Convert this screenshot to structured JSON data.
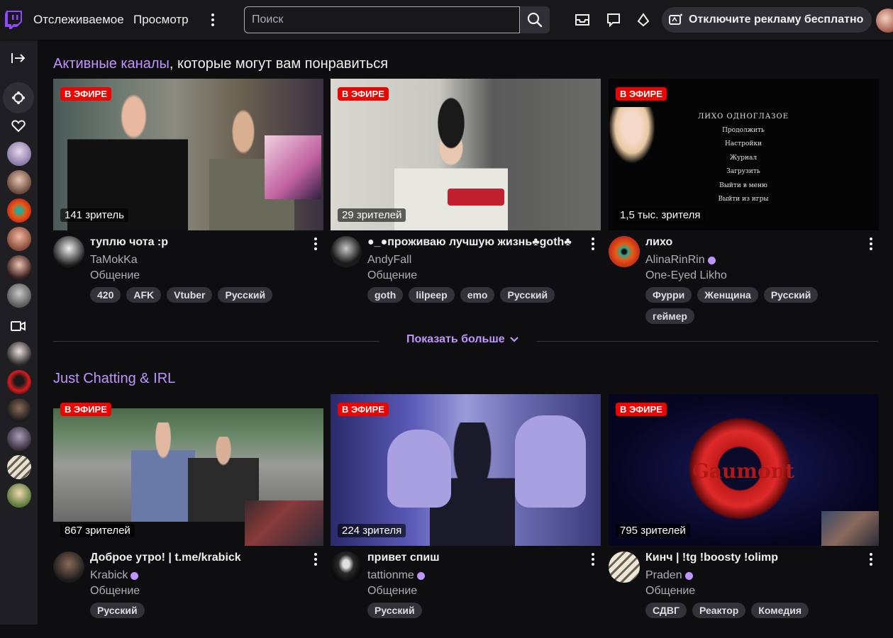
{
  "topnav": {
    "following": "Отслеживаемое",
    "browse": "Просмотр",
    "search_placeholder": "Поиск",
    "promo": "Отключите рекламу бесплатно"
  },
  "sections": [
    {
      "title_accent": "Активные каналы",
      "title_rest": ", которые могут вам понравиться",
      "cards": [
        {
          "live": "В ЭФИРЕ",
          "viewers": "141 зритель",
          "title": "туплю чота :p",
          "channel": "TaMokKa",
          "verified": false,
          "category": "Общение",
          "tags": [
            "420",
            "AFK",
            "Vtuber",
            "Русский"
          ]
        },
        {
          "live": "В ЭФИРЕ",
          "viewers": "29 зрителей",
          "title": "●_●проживаю лучшую жизнь♣goth♣",
          "channel": "AndyFall",
          "verified": false,
          "category": "Общение",
          "tags": [
            "goth",
            "lilpeep",
            "emo",
            "Русский"
          ]
        },
        {
          "live": "В ЭФИРЕ",
          "viewers": "1,5 тыс. зрителя",
          "title": "лихо",
          "channel": "AlinaRinRin",
          "verified": true,
          "category": "One-Eyed Likho",
          "tags": [
            "Фурри",
            "Женщина",
            "Русский",
            "геймер"
          ]
        }
      ]
    },
    {
      "title_accent": "Just Chatting & IRL",
      "title_rest": "",
      "cards": [
        {
          "live": "В ЭФИРЕ",
          "viewers": "867 зрителей",
          "title": "Доброе утро! | t.me/krabick",
          "channel": "Krabick",
          "verified": true,
          "category": "Общение",
          "tags": [
            "Русский"
          ]
        },
        {
          "live": "В ЭФИРЕ",
          "viewers": "224 зрителя",
          "title": "привет спиш",
          "channel": "tattionme",
          "verified": true,
          "category": "Общение",
          "tags": [
            "Русский"
          ]
        },
        {
          "live": "В ЭФИРЕ",
          "viewers": "795 зрителей",
          "title": "Кинч | !tg !boosty !olimp",
          "channel": "Praden",
          "verified": true,
          "category": "Общение",
          "tags": [
            "СДВГ",
            "Реактор",
            "Комедия"
          ]
        }
      ]
    }
  ],
  "show_more": "Показать больше",
  "thumb_texts": {
    "game_menu_title": "ЛИХО ОДНОГЛАЗОЕ",
    "game_menu_items": [
      "Продолжить",
      "Настройки",
      "Журнал",
      "Загрузить",
      "Выйти в меню",
      "Выйти из игры"
    ],
    "gaumont": "Gaumont"
  },
  "colors": {
    "accent": "#bf94ff",
    "live": "#eb0400",
    "brand": "#9146ff"
  }
}
